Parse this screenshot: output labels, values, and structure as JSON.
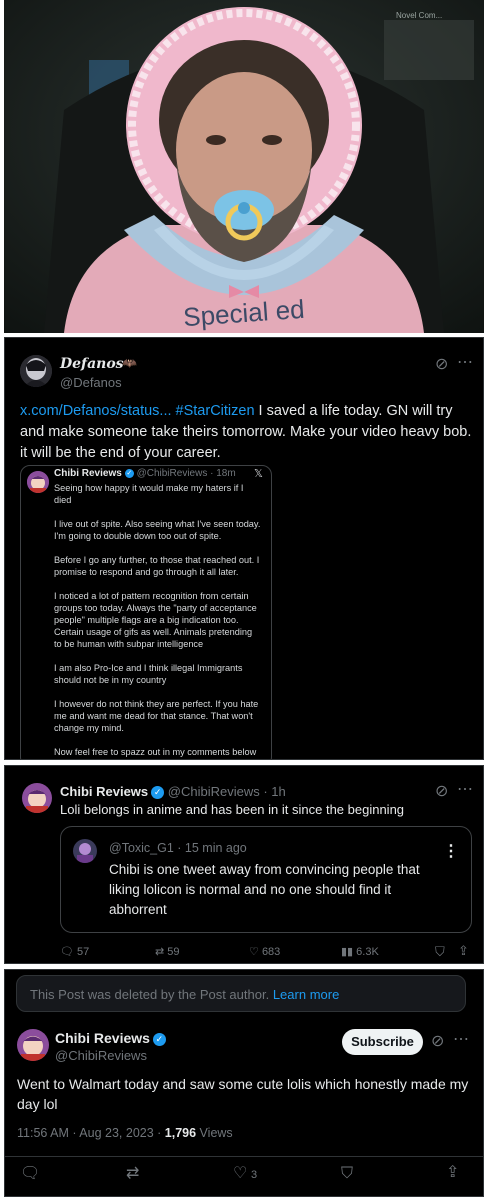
{
  "photo": {
    "shirt_text": "Special ed",
    "overlay_text": "Novel Com..."
  },
  "tweet1": {
    "display_name": "Defanos",
    "handle": "@Defanos",
    "link_text": "x.com/Defanos/status...",
    "hashtag": "#StarCitizen",
    "body": " I saved a life today. GN will try and make someone take theirs tomorrow. Make your video heavy bob. it will be the end of your career.",
    "quote": {
      "name": "Chibi Reviews",
      "handle": "@ChibiReviews",
      "time": "· 18m",
      "paragraphs": [
        "Seeing how happy it would make my haters if I died",
        "I live out of spite. Also seeing what I've seen today. I'm going to double down too out of spite.",
        "Before I go any further, to those that reached out. I promise to respond and go through it all later.",
        "I noticed a lot of pattern recognition from certain groups too today.  Always the \"party of acceptance people\" multiple flags are a big indication too. Certain usage of gifs as well. Animals pretending to be human with subpar intelligence",
        "I am also Pro-Ice and I think illegal Immigrants should not be in my country",
        "I however do not think they are perfect. If you hate me and want me dead for that stance. That won't change my mind.",
        "Now feel free to spazz out in my comments below"
      ]
    }
  },
  "tweet2": {
    "name": "Chibi Reviews",
    "handle": "@ChibiReviews",
    "time": "· 1h",
    "body": "Loli belongs in anime and has been in it since the beginning",
    "quote": {
      "handle": "@Toxic_G1",
      "time": "· 15 min ago",
      "body": "Chibi is one tweet away from convincing people that liking lolicon is normal and no one should find it abhorrent"
    },
    "stats": {
      "replies": "57",
      "reposts": "59",
      "likes": "683",
      "views": "6.3K"
    }
  },
  "tweet3": {
    "deleted_notice": "This Post was deleted by the Post author.",
    "learn_more": "Learn more",
    "name": "Chibi Reviews",
    "handle": "@ChibiReviews",
    "subscribe_label": "Subscribe",
    "body": "Went to Walmart today and saw some cute lolis which honestly made my day lol",
    "timestamp": "11:56 AM · Aug 23, 2023 · ",
    "views_count": "1,796",
    "views_label": " Views",
    "likes": "3"
  },
  "colors": {
    "background": "#000000",
    "link": "#1d9bf0",
    "muted": "#71767b",
    "text": "#e7e9ea",
    "deleted_box": "#16181c"
  }
}
